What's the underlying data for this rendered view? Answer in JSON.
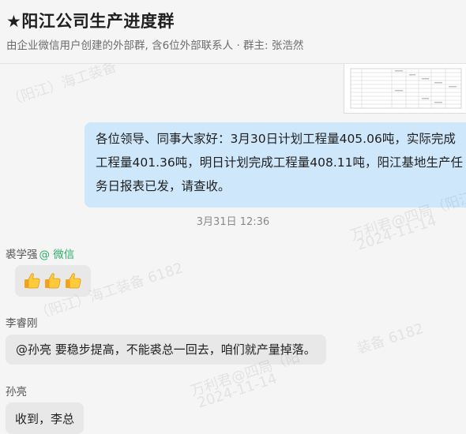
{
  "header": {
    "title": "★阳江公司生产进度群",
    "subtitle": "由企业微信用户创建的外部群, 含6位外部联系人 · 群主: 张浩然"
  },
  "messages": {
    "self": {
      "lines": [
        "各位领导、同事大家好：3月30日计划工程量405.06吨，实际完成",
        "工程量401.36吨，明日计划完成工程量408.11吨，阳江基地生产任",
        "务日报表已发，请查收。"
      ]
    },
    "timestamp": "3月31日 12:36",
    "m1": {
      "sender": "裘学强",
      "source": "@ 微信",
      "emoji_icon": "thumbs-up-icon"
    },
    "m2": {
      "sender": "李睿刚",
      "text": "@孙亮 要稳步提高，不能裘总一回去，咱们就产量掉落。"
    },
    "m3": {
      "sender": "孙亮",
      "text": "收到，李总"
    }
  },
  "watermarks": {
    "w1": "（阳江）海工装备",
    "w2": "万利君@四局（阳江",
    "w3": "2024-11-14",
    "w4": "（阳江）海工装备 6182",
    "w5": "装备 6182",
    "w6": "万利君@四局（阳",
    "w7": "2024-11-14"
  },
  "colors": {
    "self_bubble": "#cfe7fb",
    "other_bubble": "#e8e8e8",
    "wechat_green": "#2aae67"
  }
}
